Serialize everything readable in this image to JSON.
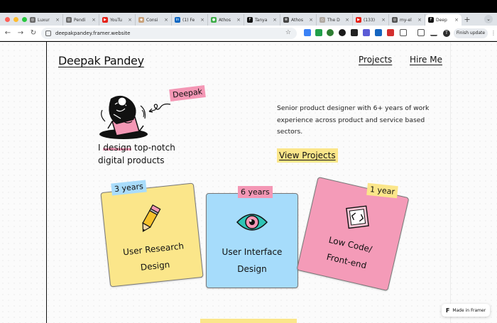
{
  "browser": {
    "tabs": [
      {
        "title": "Luxur",
        "favicon_color": "#6b6b6b",
        "favicon_glyph": "◎"
      },
      {
        "title": "Pendi",
        "favicon_color": "#6b6b6b",
        "favicon_glyph": "◎"
      },
      {
        "title": "YouTu",
        "favicon_color": "#e62117",
        "favicon_glyph": "▶"
      },
      {
        "title": "Consi",
        "favicon_color": "#c9a27a",
        "favicon_glyph": "◆"
      },
      {
        "title": "(1) Fe",
        "favicon_color": "#0a66c2",
        "favicon_glyph": "in"
      },
      {
        "title": "Athos",
        "favicon_color": "#3fae49",
        "favicon_glyph": "●"
      },
      {
        "title": "Tanya",
        "favicon_color": "#111111",
        "favicon_glyph": "F"
      },
      {
        "title": "Athos",
        "favicon_color": "#444444",
        "favicon_glyph": "✻"
      },
      {
        "title": "The D",
        "favicon_color": "#b0a9a2",
        "favicon_glyph": "◇"
      },
      {
        "title": "(133)",
        "favicon_color": "#e62117",
        "favicon_glyph": "▶"
      },
      {
        "title": "my-el",
        "favicon_color": "#555555",
        "favicon_glyph": "◎"
      },
      {
        "title": "Deep",
        "favicon_color": "#111111",
        "favicon_glyph": "F"
      }
    ],
    "new_tab": "+",
    "url": "deepakpandey.framer.website",
    "finish_update": "Finish update",
    "profile_initial": "T"
  },
  "site": {
    "logo": "Deepak Pandey",
    "nav": {
      "projects": "Projects",
      "hire": "Hire Me"
    },
    "hero": {
      "name_tag": "Deepak",
      "tagline_prefix": "I ",
      "tagline_mark": "design",
      "tagline_rest": " top-notch digital products"
    },
    "bio": "Senior product designer with 6+ years of work experience across product and service based sectors.",
    "cta": "View Projects",
    "cards": [
      {
        "line1": "User Research",
        "line2": "Design",
        "badge": "3 years",
        "color": "#fbe68a",
        "badge_color": "#a9dcfb"
      },
      {
        "line1": "User Interface",
        "line2": "Design",
        "badge": "6 years",
        "color": "#a6dcfb",
        "badge_color": "#f497b5"
      },
      {
        "line1": "Low Code/",
        "line2": "Front-end",
        "badge": "1 year",
        "color": "#f49bb8",
        "badge_color": "#fbe68a"
      }
    ],
    "framer_badge": "Made in Framer"
  }
}
